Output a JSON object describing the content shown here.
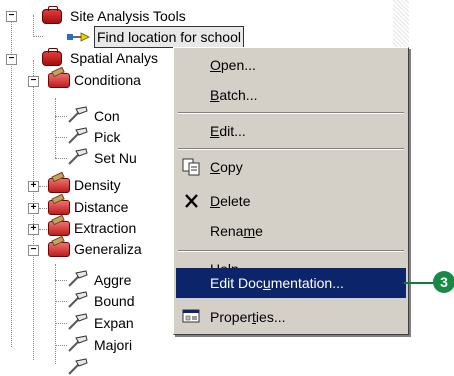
{
  "tree": {
    "items": [
      {
        "label": "Site Analysis Tools"
      },
      {
        "label": "Find location for school"
      },
      {
        "label": "Spatial Analys"
      },
      {
        "label": "Conditiona"
      },
      {
        "label": "Con"
      },
      {
        "label": "Pick"
      },
      {
        "label": "Set Nu"
      },
      {
        "label": "Density"
      },
      {
        "label": "Distance"
      },
      {
        "label": "Extraction"
      },
      {
        "label": "Generaliza"
      },
      {
        "label": "Aggre"
      },
      {
        "label": "Bound"
      },
      {
        "label": "Expan"
      },
      {
        "label": "Majori"
      }
    ],
    "collapse_symbol": "−",
    "expand_symbol": "+"
  },
  "context_menu": {
    "items": [
      {
        "pre": "",
        "u": "O",
        "post": "pen..."
      },
      {
        "pre": "",
        "u": "B",
        "post": "atch..."
      },
      {
        "pre": "",
        "u": "E",
        "post": "dit..."
      },
      {
        "pre": "",
        "u": "C",
        "post": "opy"
      },
      {
        "pre": "",
        "u": "D",
        "post": "elete"
      },
      {
        "pre": "Rena",
        "u": "m",
        "post": "e"
      },
      {
        "pre": "",
        "u": "H",
        "post": "elp"
      },
      {
        "pre": "Edit Doc",
        "u": "u",
        "post": "mentation..."
      },
      {
        "pre": "Proper",
        "u": "t",
        "post": "ies..."
      }
    ],
    "active_item": "Edit Documentation..."
  },
  "callout": {
    "label": "3",
    "color": "#178a45"
  },
  "icons": {
    "toolbox": "toolbox-icon",
    "toolset": "toolset-icon",
    "tool": "hammer-icon",
    "model": "model-icon",
    "copy": "copy-icon",
    "delete": "delete-icon",
    "properties": "properties-icon"
  }
}
